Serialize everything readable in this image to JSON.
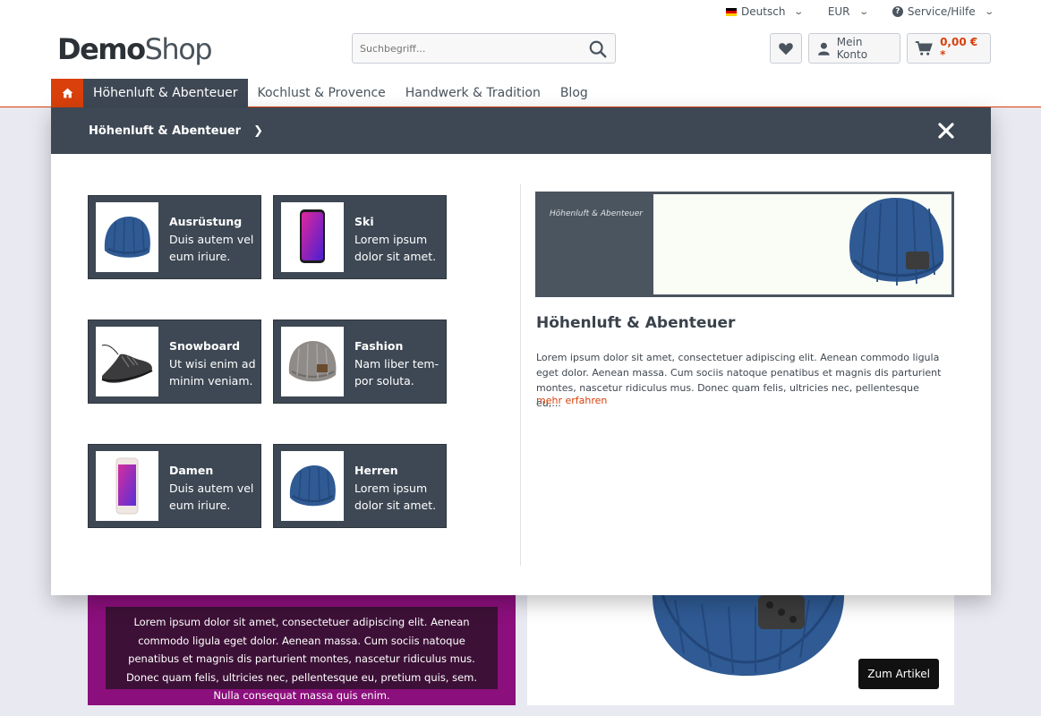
{
  "topbar": {
    "language": "Deutsch",
    "currency": "EUR",
    "service": "Service/Hilfe"
  },
  "logo": {
    "bold": "Demo",
    "light": "Shop"
  },
  "search": {
    "placeholder": "Suchbegriff..."
  },
  "actions": {
    "account": "Mein Konto",
    "cart_total": "0,00 € *"
  },
  "nav": {
    "items": [
      "Höhenluft & Abenteuer",
      "Kochlust & Provence",
      "Handwerk & Tradition",
      "Blog"
    ]
  },
  "flyout": {
    "header": "Höhenluft & Abenteuer",
    "tiles": [
      {
        "title": "Ausrüstung",
        "line1": "Duis autem vel",
        "line2": "eum iriure."
      },
      {
        "title": "Ski",
        "line1": "Lorem ipsum",
        "line2": "dolor sit amet."
      },
      {
        "title": "Snowboard",
        "line1": "Ut wisi enim ad",
        "line2": "minim veniam."
      },
      {
        "title": "Fashion",
        "line1": "Nam liber tem-",
        "line2": "por soluta."
      },
      {
        "title": "Damen",
        "line1": "Duis autem vel",
        "line2": "eum iriure."
      },
      {
        "title": "Herren",
        "line1": "Lorem ipsum",
        "line2": "dolor sit amet."
      }
    ],
    "teaser_label": "Höhenluft & Abenteuer",
    "title": "Höhenluft & Abenteuer",
    "description": "Lorem ipsum dolor sit amet, consectetuer adipiscing elit. Aenean commodo ligula eget dolor. Aenean massa. Cum sociis natoque penatibus et magnis dis parturient montes, nascetur ridiculus mus. Donec quam felis, ultricies nec, pellentesque eu,...",
    "more": "mehr erfahren"
  },
  "banner": {
    "text": "Lorem ipsum dolor sit amet, consectetuer adipiscing elit. Aenean commodo ligula eget dolor. Aenean massa. Cum sociis natoque penatibus et magnis dis parturient montes, nascetur ridiculus mus. Donec quam felis, ultricies nec, pellentesque eu, pretium quis, sem. Nulla consequat massa quis enim.",
    "cta": "Zum Artikel"
  },
  "colors": {
    "accent": "#d9400b",
    "dark": "#3e4854",
    "banner": "#8b0f7c"
  }
}
